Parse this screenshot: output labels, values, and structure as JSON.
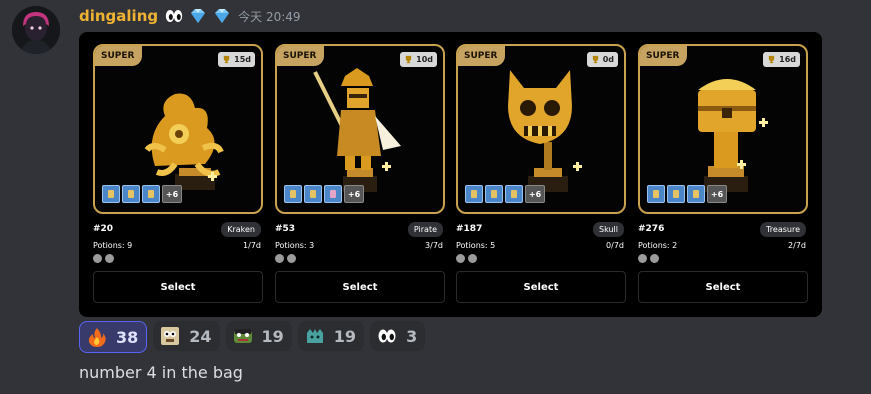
{
  "message": {
    "username": "dingaling",
    "header_emojis": [
      "eyes-emoji",
      "diamond-emoji",
      "diamond-emoji"
    ],
    "timestamp": "今天 20:49",
    "text": "number 4 in the bag"
  },
  "cards": [
    {
      "tag": "SUPER",
      "age": "15d",
      "id": "#20",
      "name": "Kraken",
      "potions": "Potions: 9",
      "ratio": "1/7d",
      "more": "+6",
      "select": "Select"
    },
    {
      "tag": "SUPER",
      "age": "10d",
      "id": "#53",
      "name": "Pirate",
      "potions": "Potions: 3",
      "ratio": "3/7d",
      "more": "+6",
      "select": "Select"
    },
    {
      "tag": "SUPER",
      "age": "0d",
      "id": "#187",
      "name": "Skull",
      "potions": "Potions: 5",
      "ratio": "0/7d",
      "more": "+6",
      "select": "Select"
    },
    {
      "tag": "SUPER",
      "age": "16d",
      "id": "#276",
      "name": "Treasure",
      "potions": "Potions: 2",
      "ratio": "2/7d",
      "more": "+6",
      "select": "Select"
    }
  ],
  "reactions": [
    {
      "emoji": "fire-emoji",
      "count": "38",
      "active": true
    },
    {
      "emoji": "meme-face-emoji",
      "count": "24",
      "active": false
    },
    {
      "emoji": "frog-emoji",
      "count": "19",
      "active": false
    },
    {
      "emoji": "crown-creature-emoji",
      "count": "19",
      "active": false
    },
    {
      "emoji": "eyes-emoji",
      "count": "3",
      "active": false
    }
  ],
  "colors": {
    "username": "#f0b232",
    "card_border": "#c8a24e",
    "super_tag": "#c7a362",
    "reaction_active_bg": "#373a6b",
    "reaction_active_border": "#5865f2"
  }
}
